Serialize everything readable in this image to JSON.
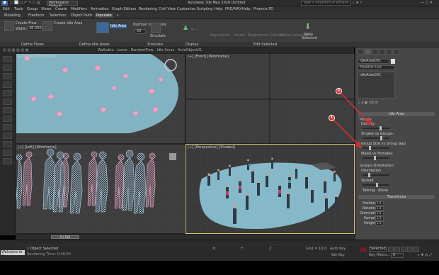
{
  "app": {
    "icon": "3ds-max-logo",
    "workspace_label": "Workspace: Default",
    "title": "Autodesk 3ds Max 2016    Untitled",
    "search_placeholder": "Type a keyword or phrase"
  },
  "menu": [
    "Edit",
    "Tools",
    "Group",
    "Views",
    "Create",
    "Modifiers",
    "Animation",
    "Graph Editors",
    "Rendering",
    "Civil View",
    "Customize",
    "Scripting",
    "Help",
    "PRO/MAX",
    "Help",
    "Phoenix FD"
  ],
  "tabs": [
    "Modeling",
    "Freeform",
    "Selection",
    "Object Paint",
    "Populate"
  ],
  "active_tab_index": 4,
  "ribbon": {
    "flow_label": "Create Flow",
    "width_label": "Width:",
    "width_value": "36.000",
    "create_idle_label": "Create Idle Area",
    "simulate_label": "Simulate",
    "idle_label": "Idle Area",
    "number_label": "Number of Frames:",
    "number_value": "50",
    "simulate_btn": "Simulate",
    "edit_btns": [
      "Regenerate",
      "Delete",
      "Regenerate Selected",
      "Delete Selected"
    ],
    "bake_label": "Bake Selected"
  },
  "ribbon_groups": [
    "Define Flows",
    "Define Idle Areas",
    "Simulate",
    "Display",
    "Edit Selected"
  ],
  "status_toolbar": "Walkable · Loose · RandomFlow · Idle Areas · AutoObject01",
  "viewports": {
    "top": "[+] [Top] [Wireframe]",
    "front": "[+] [Front] [Wireframe]",
    "left": "[+] [Left] [Wireframe]",
    "persp": "[+] [Perspective] [Shaded]"
  },
  "cmd_panel": {
    "object_name": "IdleArea001",
    "modifier_list": "Modifier List",
    "stack_item": "IdleArea001",
    "rollout_idle": "Idle Area",
    "people_label": "People",
    "density_label": "Density:",
    "density_value": 0.68,
    "singles_label": "Singles vs Groups:",
    "singles_value": 0.72,
    "group_size_label": "Group Size vs Group Gap",
    "group_size_value": 0.25,
    "males_label": "Males vs Females:",
    "males_value": 0.45,
    "groups_label": "Groups Orientation",
    "orientation_label": "Orientation",
    "orientation_value": 0.22,
    "spread_label": "Spread",
    "spread_value": 0.55,
    "talk_label": "Talking",
    "talk_value": "Alone",
    "rollout_transitions": "Transitions",
    "trans_rows": [
      {
        "label": "Position:",
        "value": "1.0"
      },
      {
        "label": "Rotation:",
        "value": "1.0"
      },
      {
        "label": "Orientation:",
        "value": "1.0"
      },
      {
        "label": "Sample:",
        "value": "1.0"
      },
      {
        "label": "Height:",
        "value": "1.0"
      }
    ]
  },
  "timeline": {
    "slider_label": "0 / 100",
    "ticks": [
      "0",
      "10",
      "20",
      "30",
      "40",
      "50",
      "60",
      "70",
      "80",
      "90",
      "100"
    ]
  },
  "status": {
    "selection": "1 Object Selected",
    "prompt": "Rendering Time: 0:00:00",
    "grid": "Grid = 10.0",
    "x": "X:",
    "y": "Y:",
    "z": "Z:",
    "welcome": "Welcome to M",
    "autokey": "Auto Key",
    "set_key": "Set Key",
    "selected": "Selected",
    "keyfilters": "Key Filters...",
    "frame": "0"
  },
  "callouts": [
    "1",
    "2"
  ],
  "colors": {
    "idle_area": "#8ec8da",
    "people_top": "#e8a6c6",
    "people_left_blue": "#a8d0ea",
    "people_left_pink": "#f0b0d0",
    "callout": "#d23030",
    "active_vp_border": "#d8c070"
  }
}
